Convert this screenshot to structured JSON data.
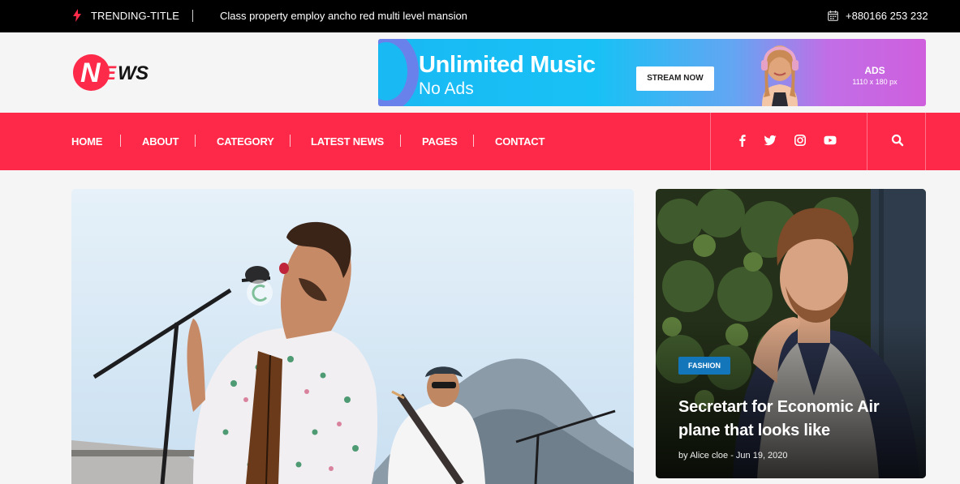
{
  "topbar": {
    "trending_label": "TRENDING-TITLE",
    "headline": "Class property employ ancho red multi level mansion",
    "phone": "+880166 253 232"
  },
  "logo": {
    "n": "N",
    "e": "E",
    "ws": "WS"
  },
  "ad": {
    "title": "Unlimited Music",
    "subtitle": "No Ads",
    "button": "STREAM NOW",
    "label": "ADS",
    "size": "1110 x 180 px"
  },
  "nav": {
    "items": [
      "HOME",
      "ABOUT",
      "CATEGORY",
      "LATEST NEWS",
      "PAGES",
      "CONTACT"
    ],
    "social": [
      "facebook-icon",
      "twitter-icon",
      "instagram-icon",
      "youtube-icon"
    ],
    "search": "search-icon"
  },
  "side_post": {
    "category": "FASHION",
    "title": "Secretart for Economic Air plane that looks like",
    "meta": "by Alice cloe - Jun 19, 2020"
  },
  "colors": {
    "accent": "#fe2848",
    "badge": "#1476ba",
    "topbar": "#000000"
  }
}
